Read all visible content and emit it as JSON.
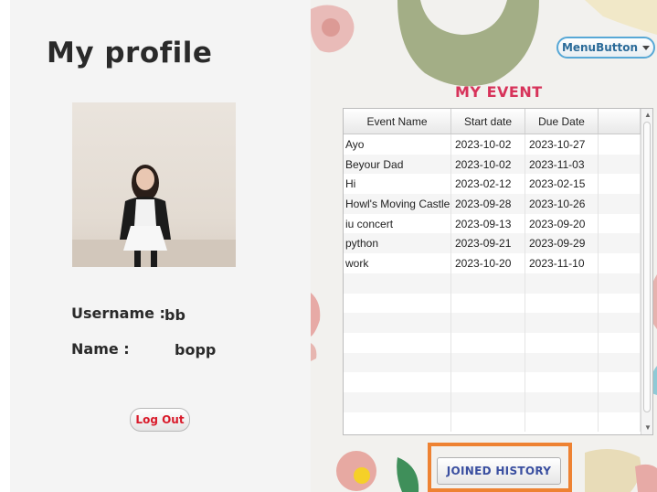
{
  "profile": {
    "title": "My profile",
    "username_label": "Username :",
    "username_value": "bb",
    "name_label": "Name :",
    "name_value": "bopp",
    "logout_label": "Log Out"
  },
  "menu": {
    "button_label": "MenuButton"
  },
  "events": {
    "title": "MY EVENT",
    "columns": [
      "Event Name",
      "Start date",
      "Due Date"
    ],
    "rows": [
      [
        "Ayo",
        "2023-10-02",
        "2023-10-27"
      ],
      [
        "Beyour Dad",
        "2023-10-02",
        "2023-11-03"
      ],
      [
        "Hi",
        "2023-02-12",
        "2023-02-15"
      ],
      [
        "Howl's Moving Castle",
        "2023-09-28",
        "2023-10-26"
      ],
      [
        "iu concert",
        "2023-09-13",
        "2023-09-20"
      ],
      [
        "python",
        "2023-09-21",
        "2023-09-29"
      ],
      [
        "work",
        "2023-10-20",
        "2023-11-10"
      ],
      [
        "",
        "",
        ""
      ],
      [
        "",
        "",
        ""
      ],
      [
        "",
        "",
        ""
      ],
      [
        "",
        "",
        ""
      ],
      [
        "",
        "",
        ""
      ],
      [
        "",
        "",
        ""
      ],
      [
        "",
        "",
        ""
      ],
      [
        "",
        "",
        ""
      ]
    ]
  },
  "history": {
    "button_label": "JOINED HISTORY"
  },
  "colors": {
    "accent_pink": "#d7335a",
    "highlight_orange": "#ee8232",
    "logout_red": "#d91a2a",
    "history_blue": "#3a4fa0"
  }
}
